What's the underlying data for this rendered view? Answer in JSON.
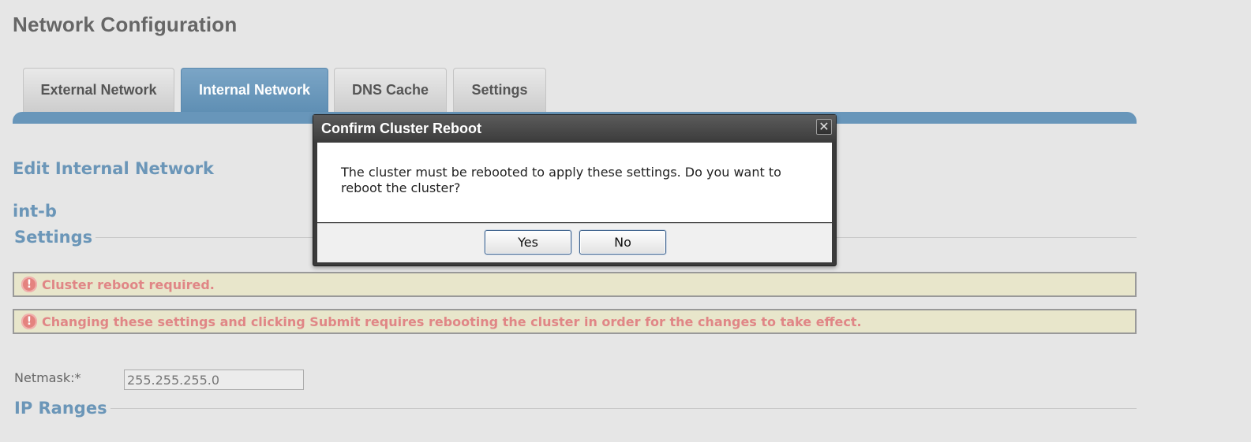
{
  "page": {
    "title": "Network Configuration"
  },
  "tabs": [
    {
      "label": "External Network",
      "active": false
    },
    {
      "label": "Internal Network",
      "active": true
    },
    {
      "label": "DNS Cache",
      "active": false
    },
    {
      "label": "Settings",
      "active": false
    }
  ],
  "content": {
    "section_title": "Edit Internal Network",
    "network_name": "int-b",
    "settings_legend": "Settings",
    "alerts": [
      {
        "icon": "warning-icon",
        "glyph": "!",
        "text": "Cluster reboot required."
      },
      {
        "icon": "warning-icon",
        "glyph": "!",
        "text": "Changing these settings and clicking Submit requires rebooting the cluster in order for the changes to take effect."
      }
    ],
    "netmask_label": "Netmask:*",
    "netmask_value": "255.255.255.0",
    "ip_ranges_legend": "IP Ranges"
  },
  "dialog": {
    "title": "Confirm Cluster Reboot",
    "close_glyph": "✕",
    "message": "The cluster must be rebooted to apply these settings. Do you want to reboot the cluster?",
    "yes_label": "Yes",
    "no_label": "No"
  },
  "colors": {
    "accent": "#6896ba",
    "alert_text": "#e08686",
    "alert_bg": "#e8e6cb"
  }
}
